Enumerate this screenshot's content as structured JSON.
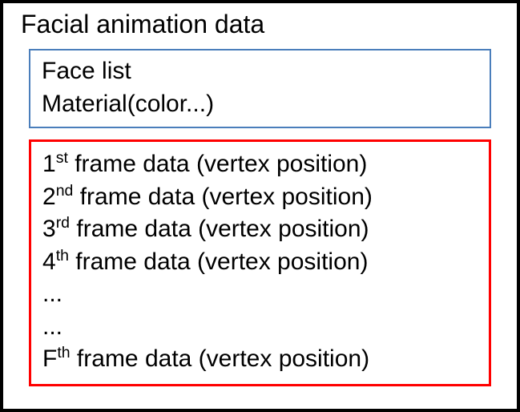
{
  "title": "Facial animation data",
  "meta_box": {
    "line1": "Face list",
    "line2": "Material(color...)"
  },
  "frames_box": {
    "rows": [
      {
        "ord_num": "1",
        "ord_suffix": "st",
        "rest": " frame data (vertex position)"
      },
      {
        "ord_num": "2",
        "ord_suffix": "nd",
        "rest": " frame data (vertex position)"
      },
      {
        "ord_num": "3",
        "ord_suffix": "rd",
        "rest": " frame data (vertex position)"
      },
      {
        "ord_num": "4",
        "ord_suffix": "th",
        "rest": " frame data (vertex position)"
      },
      {
        "ellipsis": "..."
      },
      {
        "ellipsis": "..."
      },
      {
        "ord_num": "F",
        "ord_suffix": "th",
        "rest": " frame data (vertex position)"
      }
    ]
  }
}
